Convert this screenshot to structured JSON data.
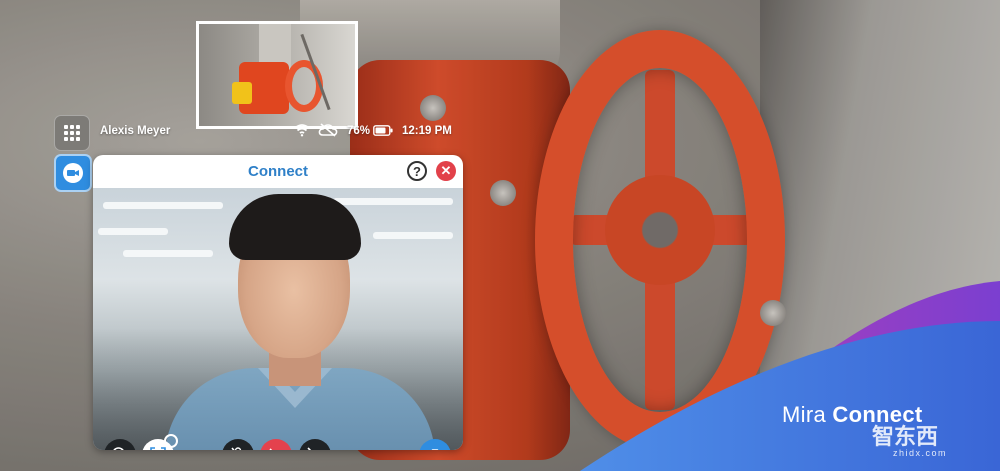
{
  "status_bar": {
    "user_name": "Alexis Meyer",
    "battery_percent": "76%",
    "time": "12:19 PM"
  },
  "connect_panel": {
    "title": "Connect",
    "help_label": "?",
    "close_label": "✕"
  },
  "branding": {
    "product_prefix": "Mira ",
    "product_name": "Connect",
    "watermark": "智东西",
    "watermark_sub": "zhidx.com"
  },
  "colors": {
    "accent_blue": "#2f80c8",
    "close_red": "#e2414a",
    "hangup_red": "#e4414d",
    "wave_purple": "#8a3fc8",
    "wave_blue": "#3e7fe6"
  },
  "icons": {
    "apps": "grid-icon",
    "video_app": "video-camera-icon",
    "wifi": "wifi-icon",
    "cloud": "cloud-off-icon",
    "battery": "battery-icon",
    "zoom": "zoom-in-icon",
    "capture": "scan-icon",
    "mute": "microphone-off-icon",
    "hangup": "phone-hangup-icon",
    "camera_off": "video-off-icon",
    "snapshot": "camera-icon"
  }
}
